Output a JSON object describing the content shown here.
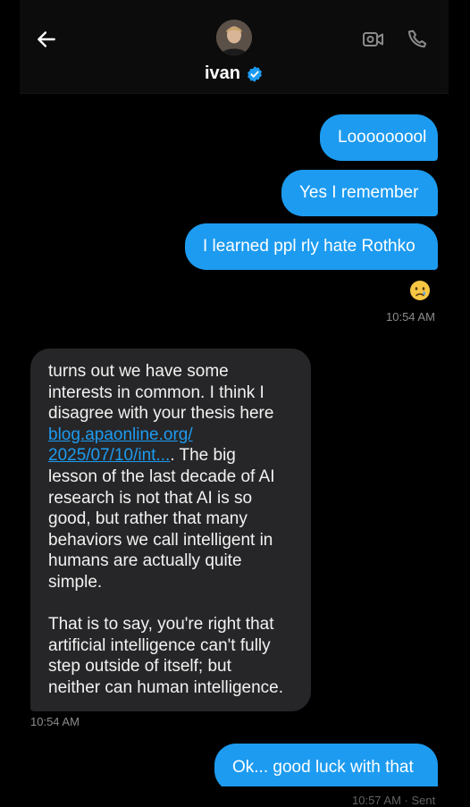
{
  "header": {
    "contact_name": "ivan",
    "back_icon": "arrow-left-icon",
    "video_icon": "video-call-icon",
    "phone_icon": "phone-icon",
    "verified_icon": "verified-badge-icon",
    "accent": "#1d9bf0"
  },
  "messages": {
    "m1": "Looooooool",
    "m2": "Yes I remember",
    "m3": "I learned ppl rly hate Rothko",
    "reaction": "😢",
    "time1": "10:54 AM",
    "incoming_line1": "turns out we have some\ninterests in common. I think I\ndisagree with your thesis here\n",
    "incoming_link": "blog.apaonline.org/\n2025/07/10/int...",
    "incoming_line2": ". The big\nlesson of the last decade of AI\nresearch is not that AI is so\ngood, but rather that many\nbehaviors we call intelligent in\nhumans are actually quite\nsimple.\n\nThat is to say, you're right that\nartificial intelligence can't fully\nstep outside of itself; but\nneither can human intelligence.",
    "time2": "10:54 AM",
    "m4": "Ok... good luck with that",
    "time3": "10:57 AM · Sent"
  }
}
